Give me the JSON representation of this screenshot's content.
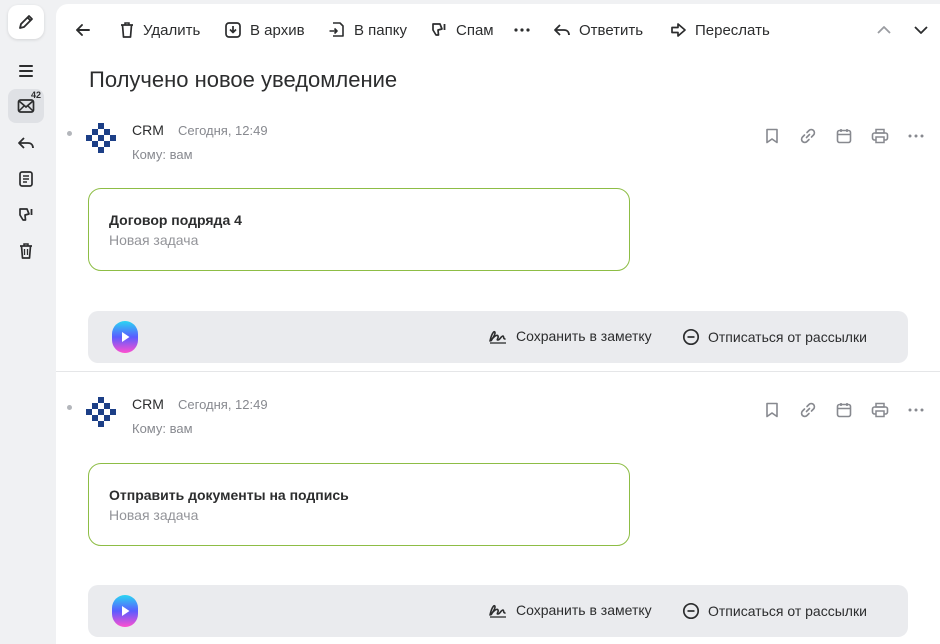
{
  "rail": {
    "inbox_badge": "42",
    "icons": [
      "pencil-icon",
      "hamburger-icon",
      "inbox-icon",
      "reply-icon",
      "document-icon",
      "spam-icon",
      "trash-icon"
    ]
  },
  "toolbar": {
    "delete_label": "Удалить",
    "archive_label": "В архив",
    "folder_label": "В папку",
    "spam_label": "Спам",
    "reply_label": "Ответить",
    "forward_label": "Переслать"
  },
  "subject": "Получено новое уведомление",
  "messages": [
    {
      "sender": "CRM",
      "time": "Сегодня, 12:49",
      "recipient": "Кому: вам",
      "card_title": "Договор подряда 4",
      "card_subtitle": "Новая задача",
      "save_note_label": "Сохранить в заметку",
      "unsubscribe_label": "Отписаться от рассылки"
    },
    {
      "sender": "CRM",
      "time": "Сегодня, 12:49",
      "recipient": "Кому: вам",
      "card_title": "Отправить документы на подпись",
      "card_subtitle": "Новая задача",
      "save_note_label": "Сохранить в заметку",
      "unsubscribe_label": "Отписаться от рассылки"
    }
  ],
  "colors": {
    "card_border": "#8dbd45",
    "avatar_blue": "#1c3f87",
    "background": "#f0f1f3"
  }
}
